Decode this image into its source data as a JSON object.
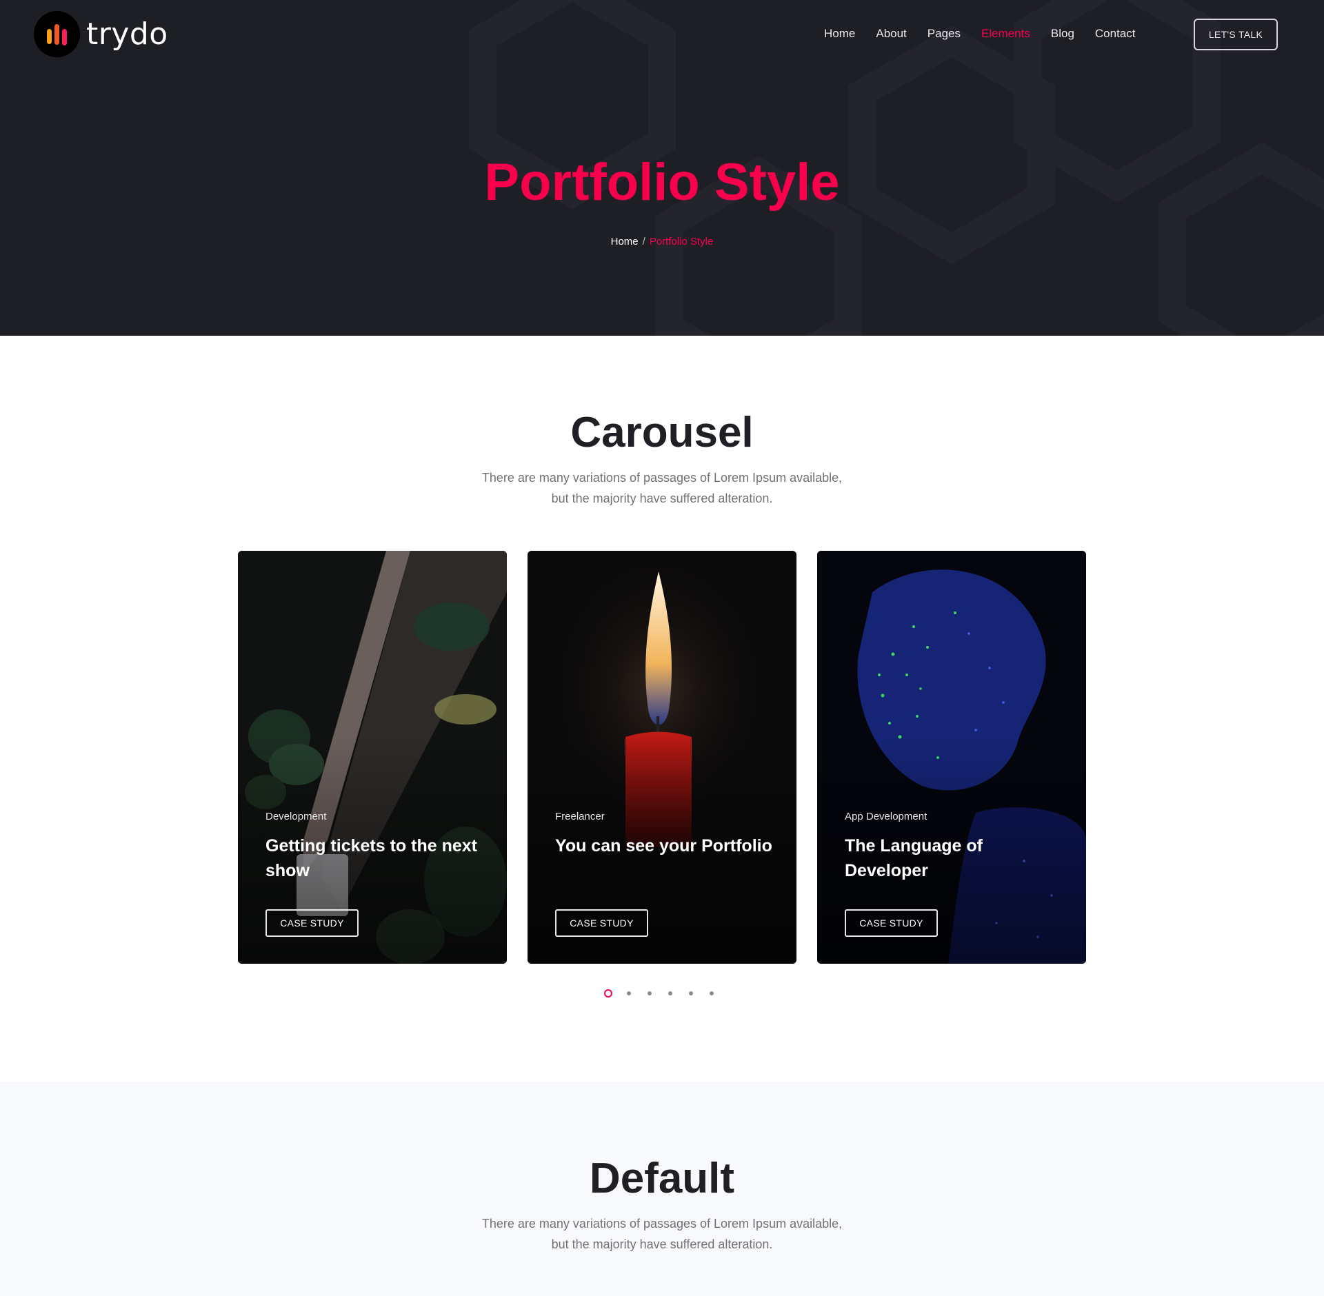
{
  "brand": {
    "name": "trydo"
  },
  "nav": {
    "items": [
      "Home",
      "About",
      "Pages",
      "Elements",
      "Blog",
      "Contact"
    ],
    "active": "Elements",
    "cta_label": "LET'S TALK"
  },
  "hero": {
    "title": "Portfolio Style",
    "breadcrumb": {
      "home": "Home",
      "separator": "/",
      "current": "Portfolio Style"
    }
  },
  "carousel_section": {
    "title": "Carousel",
    "desc_line1": "There are many variations of passages of Lorem Ipsum available,",
    "desc_line2": "but the majority have suffered alteration.",
    "cards": [
      {
        "category": "Development",
        "title": "Getting tickets to the next show",
        "button": "CASE STUDY"
      },
      {
        "category": "Freelancer",
        "title": "You can see your Portfolio",
        "button": "CASE STUDY"
      },
      {
        "category": "App Development",
        "title": "The Language of Developer",
        "button": "CASE STUDY"
      }
    ],
    "pagination": {
      "count": 6,
      "active_index": 0
    }
  },
  "default_section": {
    "title": "Default",
    "desc_line1": "There are many variations of passages of Lorem Ipsum available,",
    "desc_line2": "but the majority have suffered alteration."
  },
  "colors": {
    "accent": "#f9004d",
    "hero_bg": "#1e1f25",
    "heading": "#1f1f25",
    "body_text": "#717173",
    "alt_section_bg": "#f8f9fc"
  }
}
